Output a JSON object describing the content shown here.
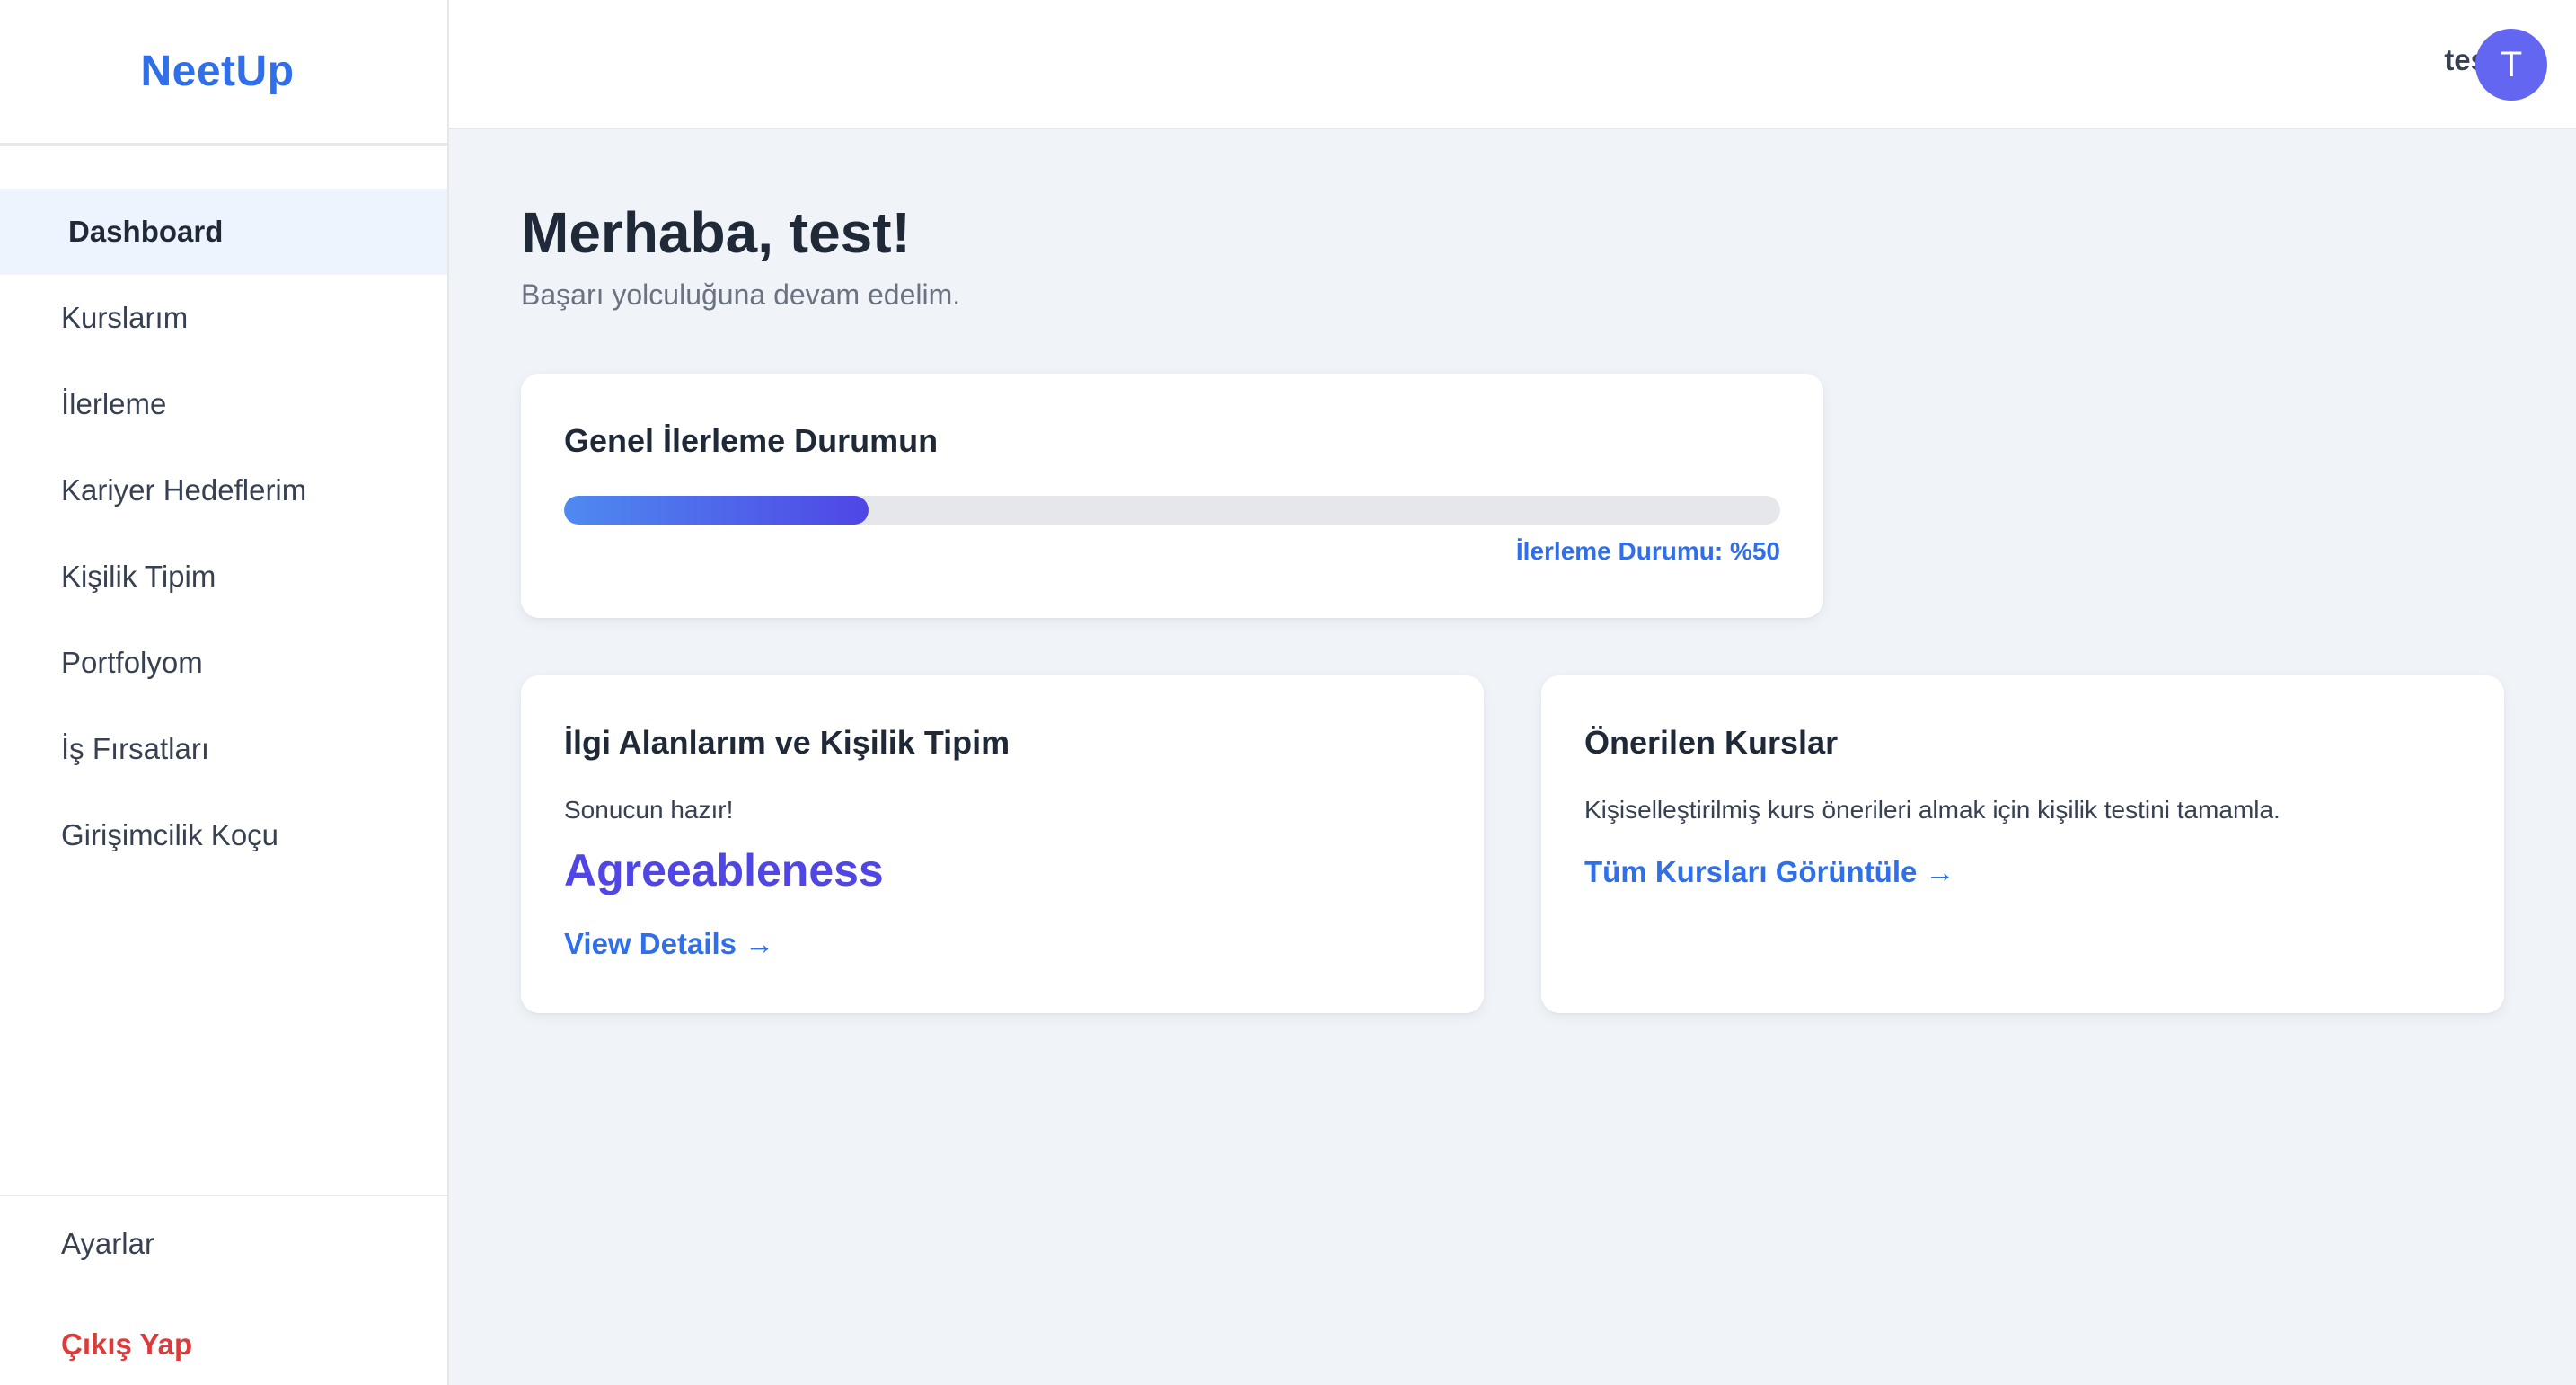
{
  "brand": {
    "logo": "NeetUp",
    "primary_color": "#2f6fea",
    "accent_color": "#4f46e5",
    "danger_color": "#dc3b3b"
  },
  "sidebar": {
    "items": [
      {
        "label": "Dashboard",
        "active": true
      },
      {
        "label": "Kurslarım",
        "active": false
      },
      {
        "label": "İlerleme",
        "active": false
      },
      {
        "label": "Kariyer Hedeflerim",
        "active": false
      },
      {
        "label": "Kişilik Tipim",
        "active": false
      },
      {
        "label": "Portfolyom",
        "active": false
      },
      {
        "label": "İş Fırsatları",
        "active": false
      },
      {
        "label": "Girişimcilik Koçu",
        "active": false
      }
    ],
    "settings_label": "Ayarlar",
    "logout_label": "Çıkış Yap"
  },
  "header": {
    "user_name": "test",
    "avatar_initial": "T",
    "avatar_color": "#6366f1"
  },
  "main": {
    "greeting": "Merhaba, test!",
    "subtitle": "Başarı yolculuğuna devam edelim.",
    "progress_card": {
      "title": "Genel İlerleme Durumun",
      "label": "İlerleme Durumu: %50",
      "fill_fraction": 0.25
    },
    "interest_card": {
      "title": "İlgi Alanlarım ve Kişilik Tipim",
      "result_text": "Sonucun hazır!",
      "personality": "Agreeableness",
      "link_label": "View Details →"
    },
    "recommend_card": {
      "title": "Önerilen Kurslar",
      "text": "Kişiselleştirilmiş kurs önerileri almak için kişilik testini tamamla.",
      "link_label": "Tüm Kursları Görüntüle →"
    }
  }
}
